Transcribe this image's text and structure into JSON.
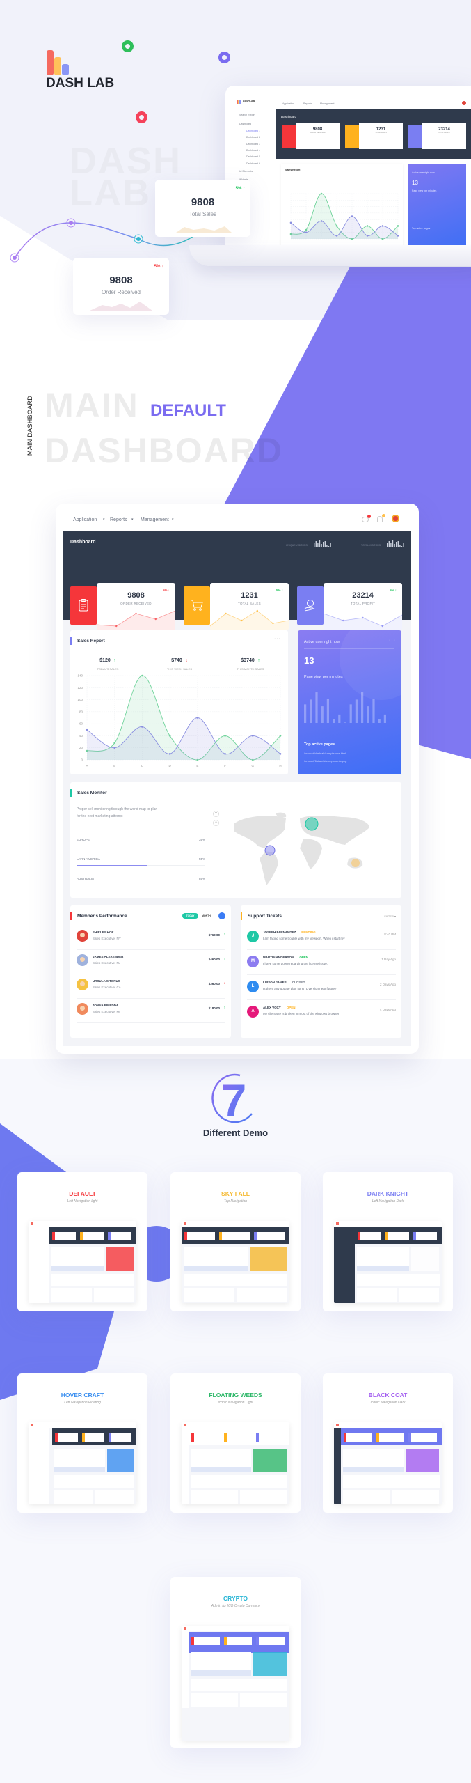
{
  "colors": {
    "accent": "#7b6cf0",
    "red": "#f5363a",
    "yellow": "#ffb21e",
    "purple": "#7a7ef2",
    "dark_header": "#2f3a4c",
    "green": "#22c55e",
    "teal": "#1ec8a5"
  },
  "brand": {
    "name": "DASH LAB",
    "watermark_line1": "DASH",
    "watermark_line2": "LAB"
  },
  "hero": {
    "float_cards": [
      {
        "value": "9808",
        "label": "Total Sales",
        "change": "5% ↑"
      },
      {
        "value": "9808",
        "label": "Order Received",
        "change": "5% ↓"
      }
    ],
    "laptop": {
      "brand": "DASHLAB",
      "search": "Search Report",
      "sidebar": [
        "Dashboard",
        "Dashboard 1",
        "Dashboard 2",
        "Dashboard 3",
        "Dashboard 4",
        "Dashboard 5",
        "Dashboard 6",
        "UI Elements",
        "Widgets"
      ]
    }
  },
  "section": {
    "vertical_label": "MAIN DASHBOARD",
    "bg_line1": "MAIN",
    "bg_line2": "DASHBOARD",
    "accent_label": "DEFAULT"
  },
  "dashboard": {
    "nav": [
      "Application",
      "Reports",
      "Management"
    ],
    "header_title": "Dashboard",
    "unique_visitors": "UNIQUE VISITORS",
    "total_visitors": "TOTAL VISITORS",
    "visitor_bars": [
      6,
      9,
      7,
      10,
      5,
      8,
      9,
      4,
      2,
      7
    ],
    "stats": [
      {
        "value": "9808",
        "label": "ORDER RECEIVED",
        "change": "5% ↓",
        "trend": "down",
        "color": "#f5363a",
        "icon": "clipboard-icon",
        "sparkline": [
          6,
          4,
          22,
          14,
          26
        ]
      },
      {
        "value": "1231",
        "label": "TOTAL SALES",
        "change": "5% ↑",
        "trend": "up",
        "color": "#ffb21e",
        "icon": "cart-icon",
        "sparkline": [
          4,
          22,
          12,
          26,
          8,
          12
        ]
      },
      {
        "value": "23214",
        "label": "TOTAL PROFIT",
        "change": "5% ↑",
        "trend": "up",
        "color": "#7a7ef2",
        "icon": "money-hand-icon",
        "sparkline": [
          22,
          12,
          16,
          4,
          20
        ]
      }
    ],
    "sales_report": {
      "title": "Sales Report",
      "stats": [
        {
          "value": "$120",
          "arrow": "↑",
          "label": "TODAY'S SALES"
        },
        {
          "value": "$740",
          "arrow": "↓",
          "label": "THIS WEEK SALES"
        },
        {
          "value": "$3740",
          "arrow": "↑",
          "label": "THIS MONTH SALES"
        }
      ]
    },
    "active_users": {
      "title": "Active user right now",
      "count": "13",
      "subtitle": "Page view per minutes",
      "bars": [
        77,
        97,
        127,
        69,
        99,
        17,
        35,
        2,
        77,
        97,
        127,
        69,
        99,
        17,
        35
      ],
      "top_pages_title": "Top active pages",
      "pages": [
        "/product/dashlab/sample-one.html",
        "/product/flatlab/ui-components.php"
      ]
    },
    "sales_monitor": {
      "title": "Sales Monitor",
      "description_line1": "Proper sell monitoring through the world map to plan",
      "description_line2": "for the next marketing attempt",
      "zoom_in": "+",
      "zoom_out": "−",
      "regions": [
        {
          "name": "EUROPE",
          "percent": "35%",
          "value": 35,
          "color": "#1ec8a5"
        },
        {
          "name": "LATIN AMERICA",
          "percent": "55%",
          "value": 55,
          "color": "#8c8cf0"
        },
        {
          "name": "AUSTRALIA",
          "percent": "85%",
          "value": 85,
          "color": "#ffc04d"
        }
      ]
    },
    "members": {
      "title": "Member's Performance",
      "tab_today": "TODAY",
      "tab_month": "MONTH",
      "more": "...",
      "items": [
        {
          "name": "SHIRLEY HOE",
          "role": "Sales Executive, NY",
          "amount": "$760.00",
          "arrow": "↑",
          "trend": "up",
          "avatar_color": "#e0443a"
        },
        {
          "name": "JAMES ALEXENDER",
          "role": "Sales Executive, FL",
          "amount": "$460.00",
          "arrow": "↑",
          "trend": "up",
          "avatar_color": "#9fb2dd"
        },
        {
          "name": "URSULA SITORUS",
          "role": "Sales Executive, CA",
          "amount": "$360.00",
          "arrow": "↓",
          "trend": "down",
          "avatar_color": "#f5c242"
        },
        {
          "name": "JONNA PINEDDA",
          "role": "Sales Executive, MI",
          "amount": "$180.00",
          "arrow": "↑",
          "trend": "up",
          "avatar_color": "#f08a5d"
        }
      ]
    },
    "tickets": {
      "title": "Support Tickets",
      "filter": "FILTER ▾",
      "more": "...",
      "items": [
        {
          "initial": "J",
          "name": "JOSEPH FARNANDEZ",
          "status": "PENDING",
          "status_color": "#ffb21e",
          "message": "I am facing some trouble with my viewport. When i start my",
          "time": "8:40 PM",
          "avatar_color": "#1ec8a5"
        },
        {
          "initial": "M",
          "name": "MARTIN ANDERSON",
          "status": "OPEN",
          "status_color": "#22c55e",
          "message": "I have some query regarding the license issue.",
          "time": "1 Day Ago",
          "avatar_color": "#8c7cf0"
        },
        {
          "initial": "L",
          "name": "LIBSON JAMES",
          "status": "CLOSED",
          "status_color": "#6b7280",
          "message": "Is there any update plan for RTL version near future?",
          "time": "2 Days Ago",
          "avatar_color": "#2f8cf0"
        },
        {
          "initial": "A",
          "name": "ALEX VOXY",
          "status": "OPEN",
          "status_color": "#ffb21e",
          "message": "My client site is broken in most of the windows browser",
          "time": "4 Days Ago",
          "avatar_color": "#e5197a"
        }
      ]
    }
  },
  "chart_data": {
    "type": "area",
    "title": "",
    "categories": [
      "A",
      "B",
      "C",
      "D",
      "E",
      "F",
      "G",
      "H"
    ],
    "yticks": [
      "0",
      "20",
      "40",
      "60",
      "80",
      "100",
      "120",
      "140"
    ],
    "ylim": [
      0,
      140
    ],
    "grid": true,
    "series": [
      {
        "values": [
          15,
          28,
          140,
          40,
          0,
          40,
          0,
          40
        ],
        "color": "#6fd39a"
      },
      {
        "values": [
          50,
          20,
          55,
          10,
          70,
          10,
          40,
          10
        ],
        "color": "#8a8fe0"
      }
    ]
  },
  "demos": {
    "count": "7",
    "title": "Different Demo",
    "items": [
      {
        "title": "DEFAULT",
        "subtitle": "Left Navigation light",
        "color": "#f5363a",
        "layout": "left-light"
      },
      {
        "title": "SKY FALL",
        "subtitle": "Top Navigation",
        "color": "#f5b82e",
        "layout": "top"
      },
      {
        "title": "DARK KNIGHT",
        "subtitle": "Left Navigation Dark",
        "color": "#7a7ef2",
        "layout": "left-dark"
      },
      {
        "title": "HOVER CRAFT",
        "subtitle": "Left Navigation Floating",
        "color": "#3b8ff0",
        "layout": "left-floating"
      },
      {
        "title": "FLOATING WEEDS",
        "subtitle": "Iconic Navigation Light",
        "color": "#2fb86a",
        "layout": "iconic-light"
      },
      {
        "title": "BLACK COAT",
        "subtitle": "Iconic Navigation Dark",
        "color": "#a35ef0",
        "layout": "iconic-dark"
      },
      {
        "title": "CRYPTO",
        "subtitle": "Admin for ICO Crypto Currency",
        "color": "#2ab6d6",
        "layout": "crypto"
      }
    ]
  }
}
